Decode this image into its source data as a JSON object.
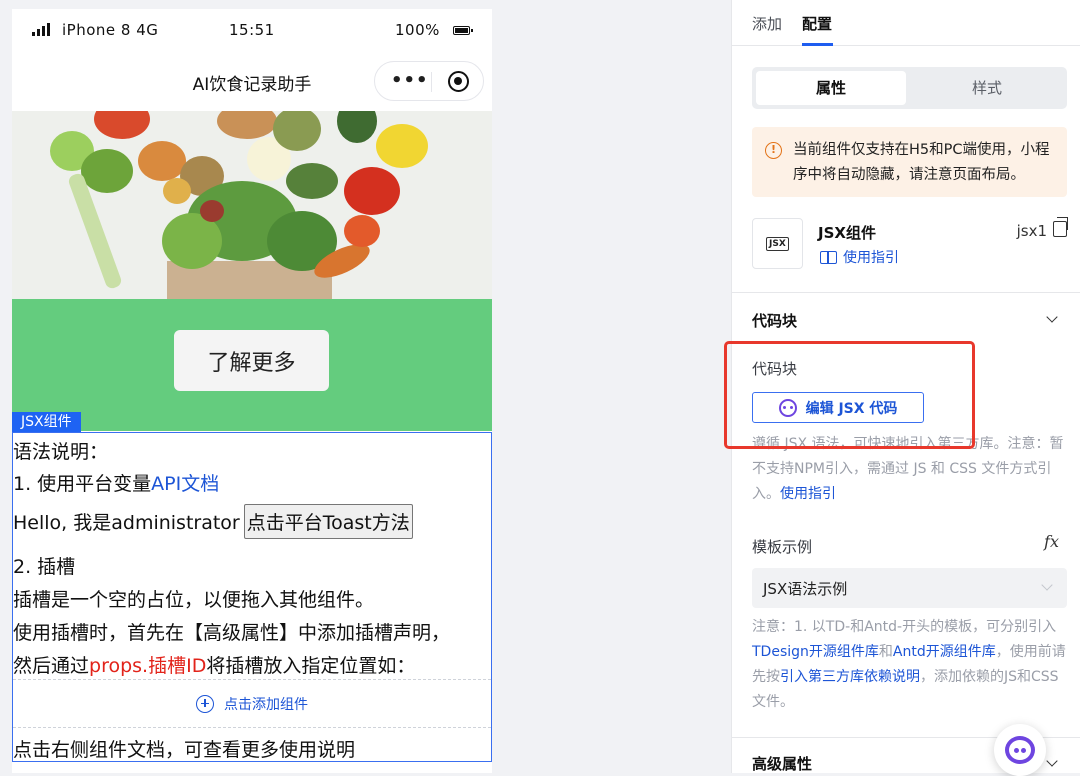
{
  "phone": {
    "status_bar": {
      "carrier": "iPhone 8  4G",
      "time": "15:51",
      "battery": "100%"
    },
    "nav_title": "AI饮食记录助手",
    "capsule_more": "•••",
    "learn_more_button": "了解更多",
    "jsx_tag": "JSX组件",
    "jsx_content": {
      "syntax_heading": "语法说明：",
      "item1_prefix": "1. 使用平台变量",
      "item1_link": "API文档",
      "hello_text": "Hello, 我是administrator",
      "toast_button": "点击平台Toast方法",
      "item2": "2. 插槽",
      "slot_desc": "插槽是一个空的占位，以便拖入其他组件。",
      "slot_usage": "使用插槽时，首先在【高级属性】中添加插槽声明，",
      "slot_then_prefix": "然后通过",
      "slot_then_code": "props.插槽ID",
      "slot_then_suffix": "将插槽放入指定位置如：",
      "add_component": "点击添加组件",
      "footer_note": "点击右侧组件文档，可查看更多使用说明"
    }
  },
  "panel": {
    "tabs": [
      {
        "label": "添加",
        "active": false
      },
      {
        "label": "配置",
        "active": true
      }
    ],
    "segment": [
      {
        "label": "属性",
        "active": true
      },
      {
        "label": "样式",
        "active": false
      }
    ],
    "warning": {
      "icon": "!",
      "text": "当前组件仅支持在H5和PC端使用，小程序中将自动隐藏，请注意页面布局。"
    },
    "component": {
      "icon_text": "JSX",
      "name": "JSX组件",
      "guide_link": "使用指引",
      "id": "jsx1"
    },
    "code_section": {
      "title": "代码块",
      "label": "代码块",
      "edit_button": "编辑 JSX 代码",
      "desc_prefix": "遵循 JSX 语法，可快速地引入第三方库。注意：暂不支持NPM引入，需通过 JS 和 CSS 文件方式引入。",
      "desc_link": "使用指引"
    },
    "template_section": {
      "label": "模板示例",
      "fx": "fx",
      "selected": "JSX语法示例",
      "note_prefix": "注意：1. 以TD-和Antd-开头的模板，可分别引入",
      "note_link1": "TDesign开源组件库",
      "note_and": "和",
      "note_link2": "Antd开源组件库",
      "note_mid": "，使用前请先按",
      "note_link3": "引入第三方库依赖说明",
      "note_suffix": "，添加依赖的JS和CSS文件。"
    },
    "advanced_section": {
      "title": "高级属性"
    }
  },
  "colors": {
    "accent": "#1d55d6",
    "highlight_box": "#e8382c",
    "green_band": "#64cc7e",
    "warning_bg": "#fdf1e6"
  }
}
